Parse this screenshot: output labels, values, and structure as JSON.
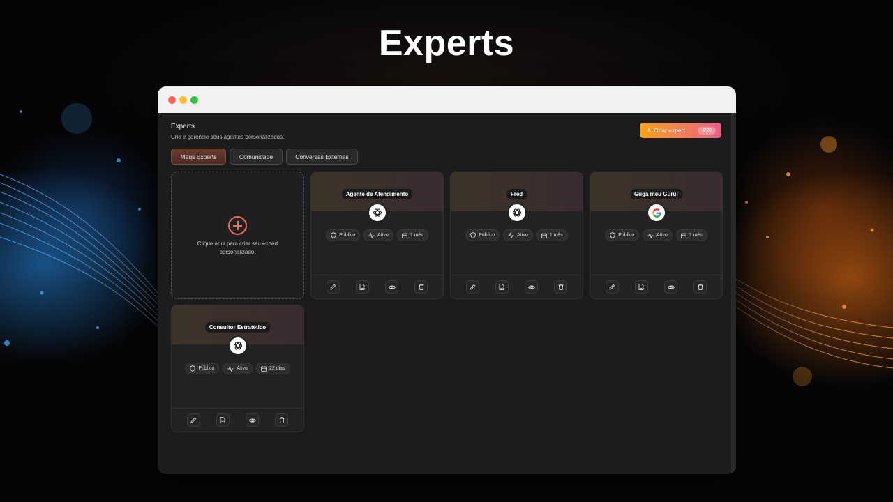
{
  "hero_title": "Experts",
  "header": {
    "title": "Experts",
    "subtitle": "Crie e gerencie seus agentes personalizados.",
    "create_label": "Criar expert",
    "create_count": "4/20"
  },
  "tabs": [
    {
      "label": "Meus Experts",
      "active": true
    },
    {
      "label": "Comunidade",
      "active": false
    },
    {
      "label": "Conversas Externas",
      "active": false
    }
  ],
  "new_card": {
    "text": "Clique aqui para criar seu expert personalizado."
  },
  "experts": [
    {
      "name": "Agente de Atendimento",
      "logo": "openai-icon",
      "visibility": "Público",
      "status": "Ativo",
      "age": "1 mês"
    },
    {
      "name": "Fred",
      "logo": "openai-icon",
      "visibility": "Público",
      "status": "Ativo",
      "age": "1 mês"
    },
    {
      "name": "Guga meu Guru!",
      "logo": "google-icon",
      "visibility": "Público",
      "status": "Ativo",
      "age": "1 mês"
    },
    {
      "name": "Consultor Estratético",
      "logo": "openai-icon",
      "visibility": "Público",
      "status": "Ativo",
      "age": "22 dias"
    }
  ],
  "colors": {
    "accent_start": "#f7a21b",
    "accent_end": "#ec5e8a",
    "plus": "#f16b5b"
  }
}
